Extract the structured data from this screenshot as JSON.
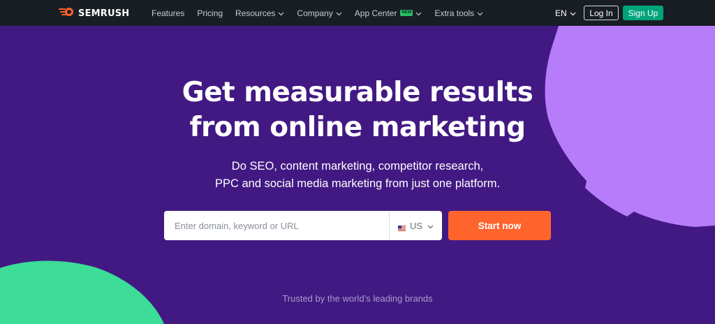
{
  "brand": {
    "name": "SEMRUSH",
    "logo_icon": "semrush-flame-icon",
    "logo_color": "#ff642d"
  },
  "nav": {
    "items": [
      {
        "label": "Features",
        "has_dropdown": false
      },
      {
        "label": "Pricing",
        "has_dropdown": false
      },
      {
        "label": "Resources",
        "has_dropdown": true
      },
      {
        "label": "Company",
        "has_dropdown": true
      },
      {
        "label": "App Center",
        "has_dropdown": true,
        "badge": "NEW"
      },
      {
        "label": "Extra tools",
        "has_dropdown": true
      }
    ],
    "language": "EN",
    "login_label": "Log In",
    "signup_label": "Sign Up"
  },
  "hero": {
    "title_line1": "Get measurable results",
    "title_line2": "from online marketing",
    "subtitle_line1": "Do SEO, content marketing, competitor research,",
    "subtitle_line2": "PPC and social media marketing from just one platform."
  },
  "search": {
    "placeholder": "Enter domain, keyword or URL",
    "value": "",
    "country": "US",
    "country_flag_icon": "us-flag-icon",
    "submit_label": "Start now"
  },
  "trusted_text": "Trusted by the world’s leading brands",
  "colors": {
    "background": "#421983",
    "nav_background": "#181e24",
    "accent_orange": "#ff642d",
    "signup_green": "#00a47a",
    "shape_purple": "#b67cf9",
    "shape_green": "#3ddc97"
  }
}
